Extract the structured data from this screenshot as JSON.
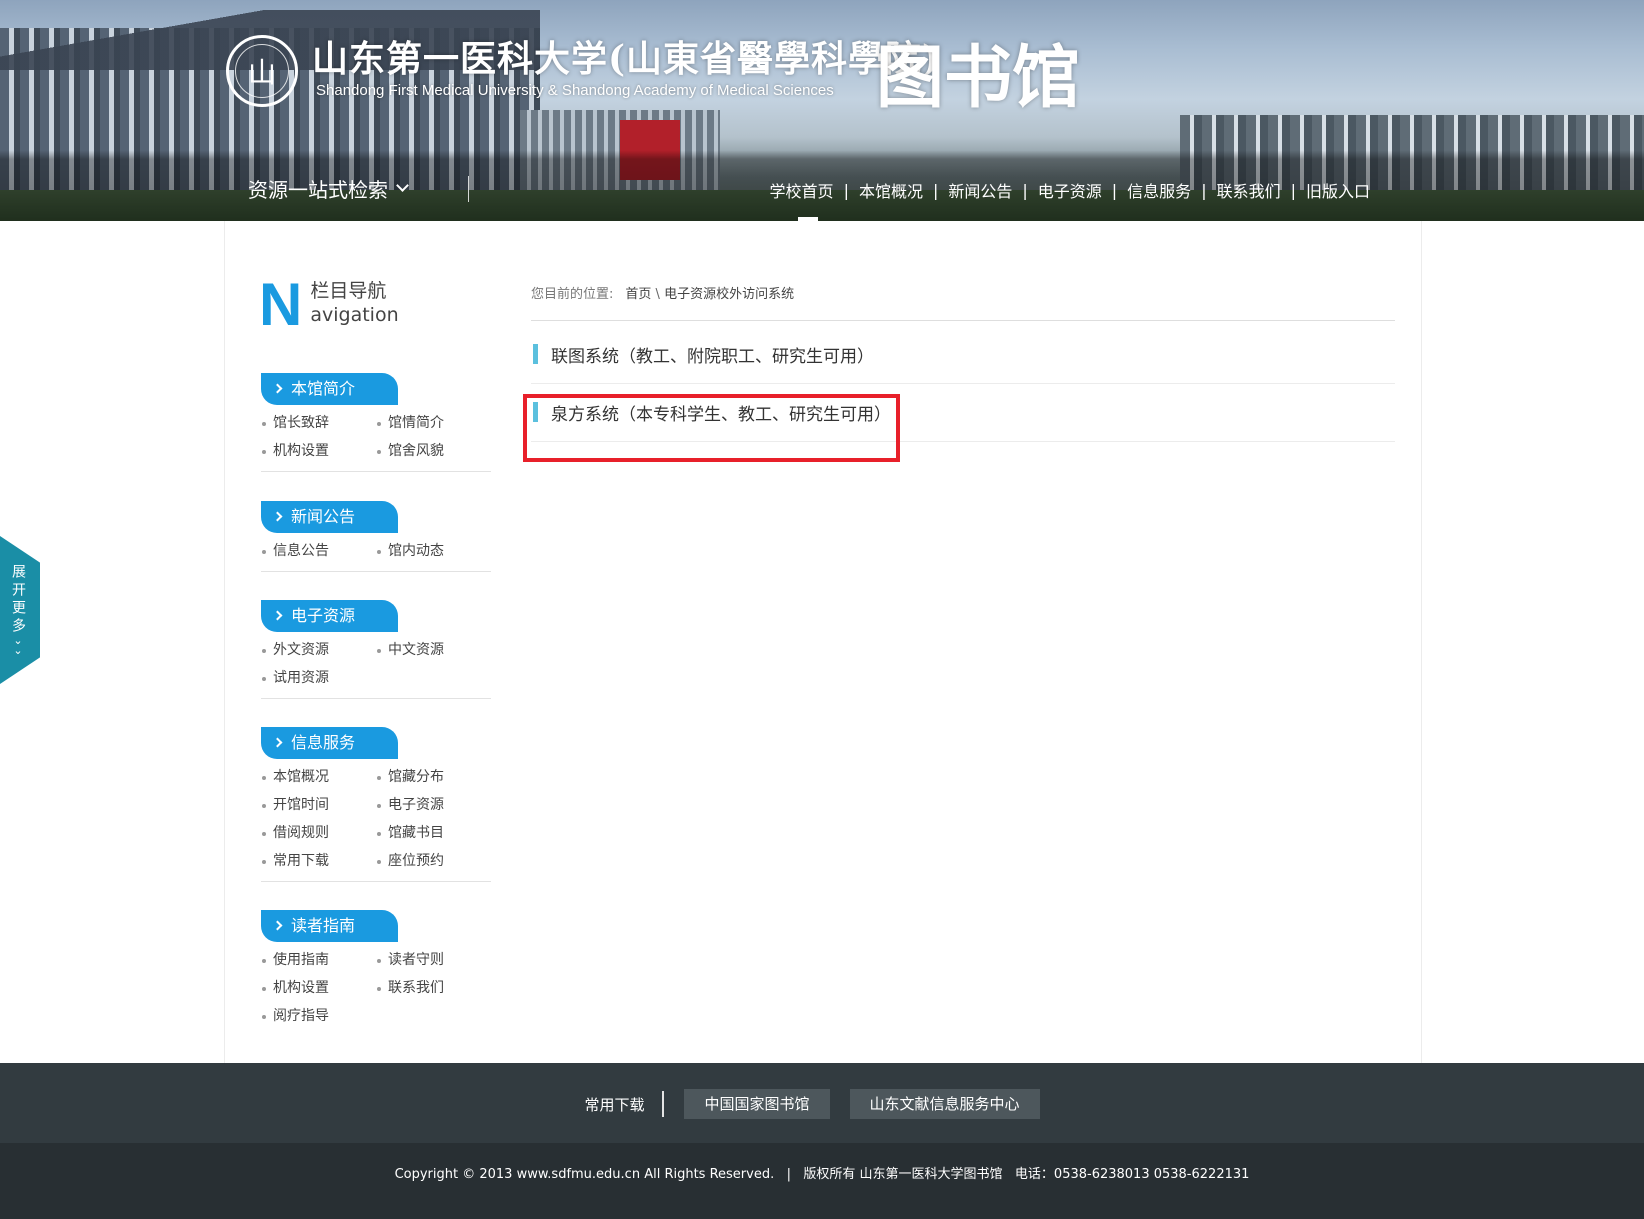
{
  "header": {
    "logo_seal_char": "山",
    "logo_cn": "山东第一医科大学(山東省醫學科學院)",
    "logo_en": "Shandong First Medical University   &   Shandong Academy of Medical Sciences",
    "logo_library": "图书馆",
    "search_dropdown": "资源一站式检索",
    "nav": [
      "学校首页",
      "本馆概况",
      "新闻公告",
      "电子资源",
      "信息服务",
      "联系我们",
      "旧版入口"
    ]
  },
  "sidebar": {
    "title_letter": "N",
    "title_cn": "栏目导航",
    "title_en": "avigation",
    "sections": [
      {
        "title": "本馆简介",
        "links": [
          "馆长致辞",
          "馆情简介",
          "机构设置",
          "馆舍风貌"
        ]
      },
      {
        "title": "新闻公告",
        "links": [
          "信息公告",
          "馆内动态"
        ]
      },
      {
        "title": "电子资源",
        "links": [
          "外文资源",
          "中文资源",
          "试用资源"
        ]
      },
      {
        "title": "信息服务",
        "links": [
          "本馆概况",
          "馆藏分布",
          "开馆时间",
          "电子资源",
          "借阅规则",
          "馆藏书目",
          "常用下载",
          "座位预约"
        ]
      },
      {
        "title": "读者指南",
        "links": [
          "使用指南",
          "读者守则",
          "机构设置",
          "联系我们",
          "阅疗指导"
        ]
      }
    ]
  },
  "breadcrumb": {
    "label": "您目前的位置:",
    "home": "首页",
    "sep": "\\",
    "current": "电子资源校外访问系统"
  },
  "systems": [
    "联图系统（教工、附院职工、研究生可用）",
    "泉方系统（本专科学生、教工、研究生可用）"
  ],
  "side_float": {
    "text": "展开更多",
    "icon": "double-chevron-down-icon"
  },
  "footer": {
    "plain_link": "常用下载",
    "buttons": [
      "中国国家图书馆",
      "山东文献信息服务中心"
    ],
    "copyright": "Copyright © 2013 www.sdfmu.edu.cn All Rights Reserved.   |   版权所有 山东第一医科大学图书馆   电话：0538-6238013 0538-6222131"
  },
  "colors": {
    "accent": "#1a9ae0",
    "highlight": "#e8202a",
    "footer_top": "#323b40",
    "footer_bottom": "#282f33",
    "side_float": "#1a8ea6"
  }
}
